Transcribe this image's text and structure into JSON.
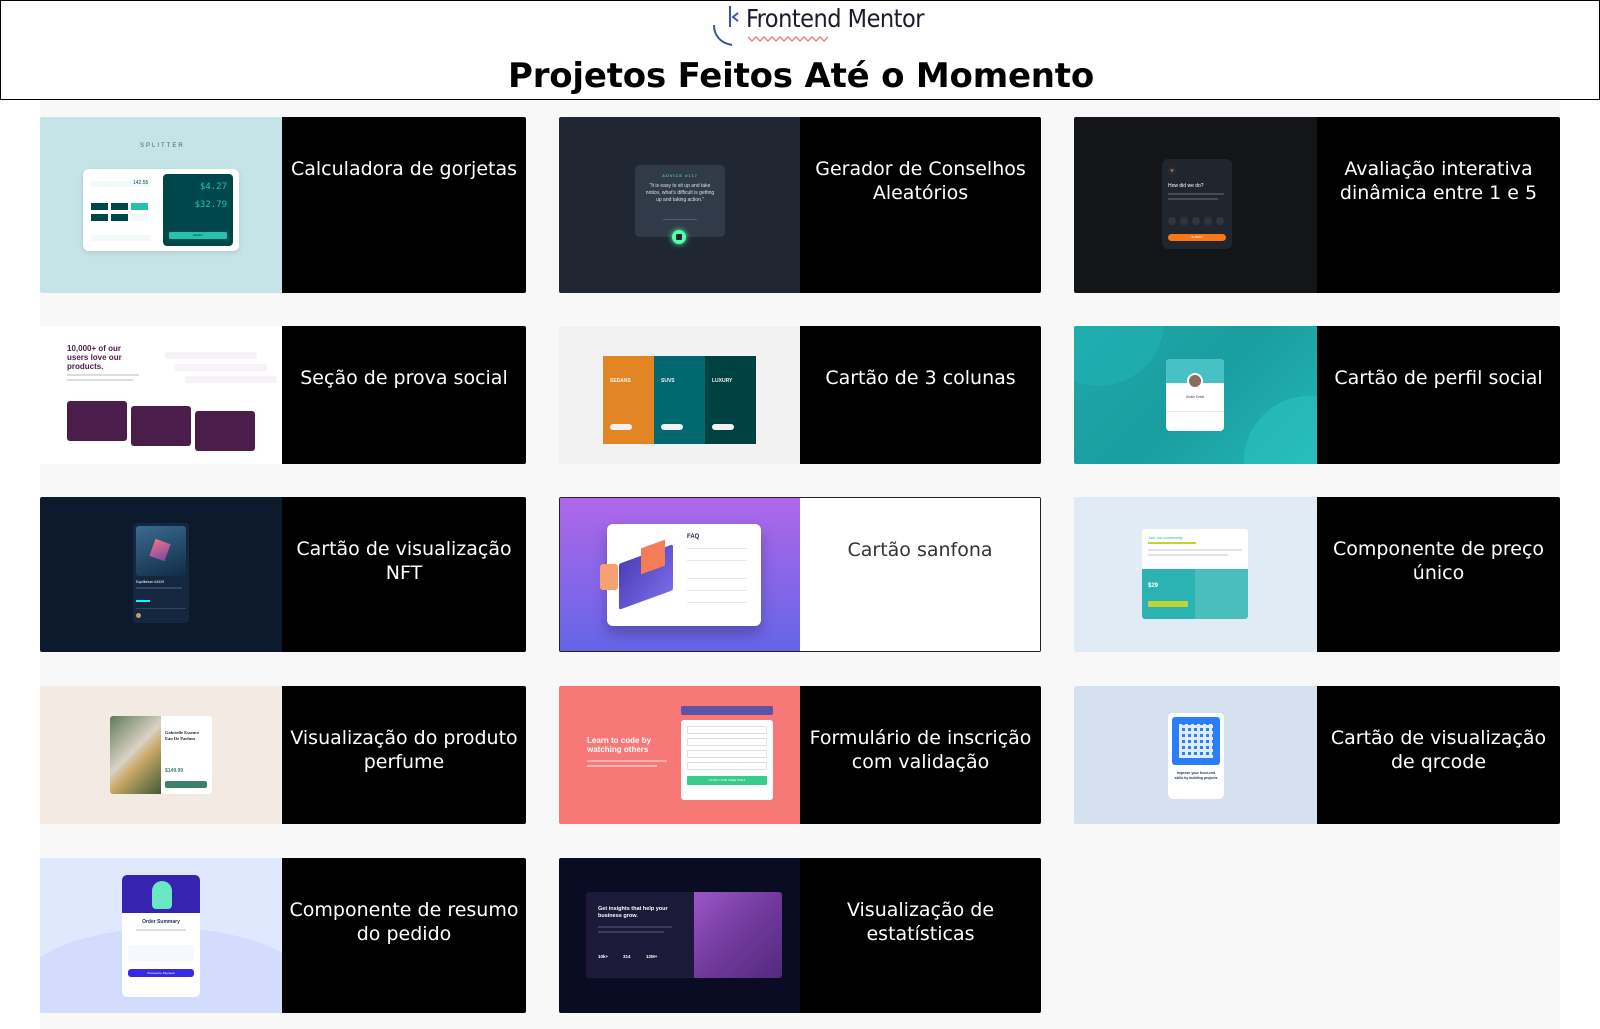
{
  "header": {
    "logo_text": "Frontend Mentor",
    "page_title": "Projetos Feitos Até o Momento"
  },
  "projects": [
    {
      "label": "Calculadora de gorjetas",
      "preview": {
        "brand": "SPLITTER",
        "tip_amount": "$4.27",
        "total": "$32.79",
        "bill": "142.55",
        "reset": "RESET"
      }
    },
    {
      "label": "Gerador de Conselhos Aleatórios",
      "preview": {
        "heading": "ADVICE #117",
        "quote": "“It is easy to sit up and take notice, what's difficult is getting up and taking action.”"
      }
    },
    {
      "label": "Avaliação interativa dinâmica entre 1 e 5",
      "preview": {
        "heading": "How did we do?",
        "button": "SUBMIT"
      }
    },
    {
      "label": "Seção de prova social",
      "preview": {
        "heading": "10,000+ of our users love our products."
      }
    },
    {
      "label": "Cartão de 3 colunas",
      "preview": {
        "col1": "SEDANS",
        "col2": "SUVS",
        "col3": "LUXURY"
      }
    },
    {
      "label": "Cartão de perfil social",
      "preview": {
        "name": "Victor Crest"
      }
    },
    {
      "label": "Cartão de visualização NFT",
      "preview": {
        "title": "Equilibrium #3429"
      }
    },
    {
      "label": "Cartão sanfona",
      "preview": {
        "heading": "FAQ"
      }
    },
    {
      "label": "Componente de preço único",
      "preview": {
        "heading": "Join our community",
        "price": "$29"
      }
    },
    {
      "label": "Visualização do produto perfume",
      "preview": {
        "title": "Gabrielle Essence Eau De Parfum",
        "price": "$149.99"
      }
    },
    {
      "label": "Formulário de inscrição com validação",
      "preview": {
        "heading": "Learn to code by watching others",
        "button": "CLAIM YOUR FREE TRIAL"
      }
    },
    {
      "label": "Cartão de visualização de qrcode",
      "preview": {
        "caption": "Improve your front-end skills by building projects"
      }
    },
    {
      "label": "Componente de resumo do pedido",
      "preview": {
        "heading": "Order Summary",
        "button": "Proceed to Payment"
      }
    },
    {
      "label": "Visualização de estatísticas",
      "preview": {
        "heading": "Get insights that help your business grow.",
        "stat1": "10k+",
        "stat2": "314",
        "stat3": "12M+"
      }
    }
  ],
  "colors": {
    "label_dark_bg": "#000000",
    "label_light_bg": "#ffffff",
    "page_bg": "#f8f8f9"
  }
}
